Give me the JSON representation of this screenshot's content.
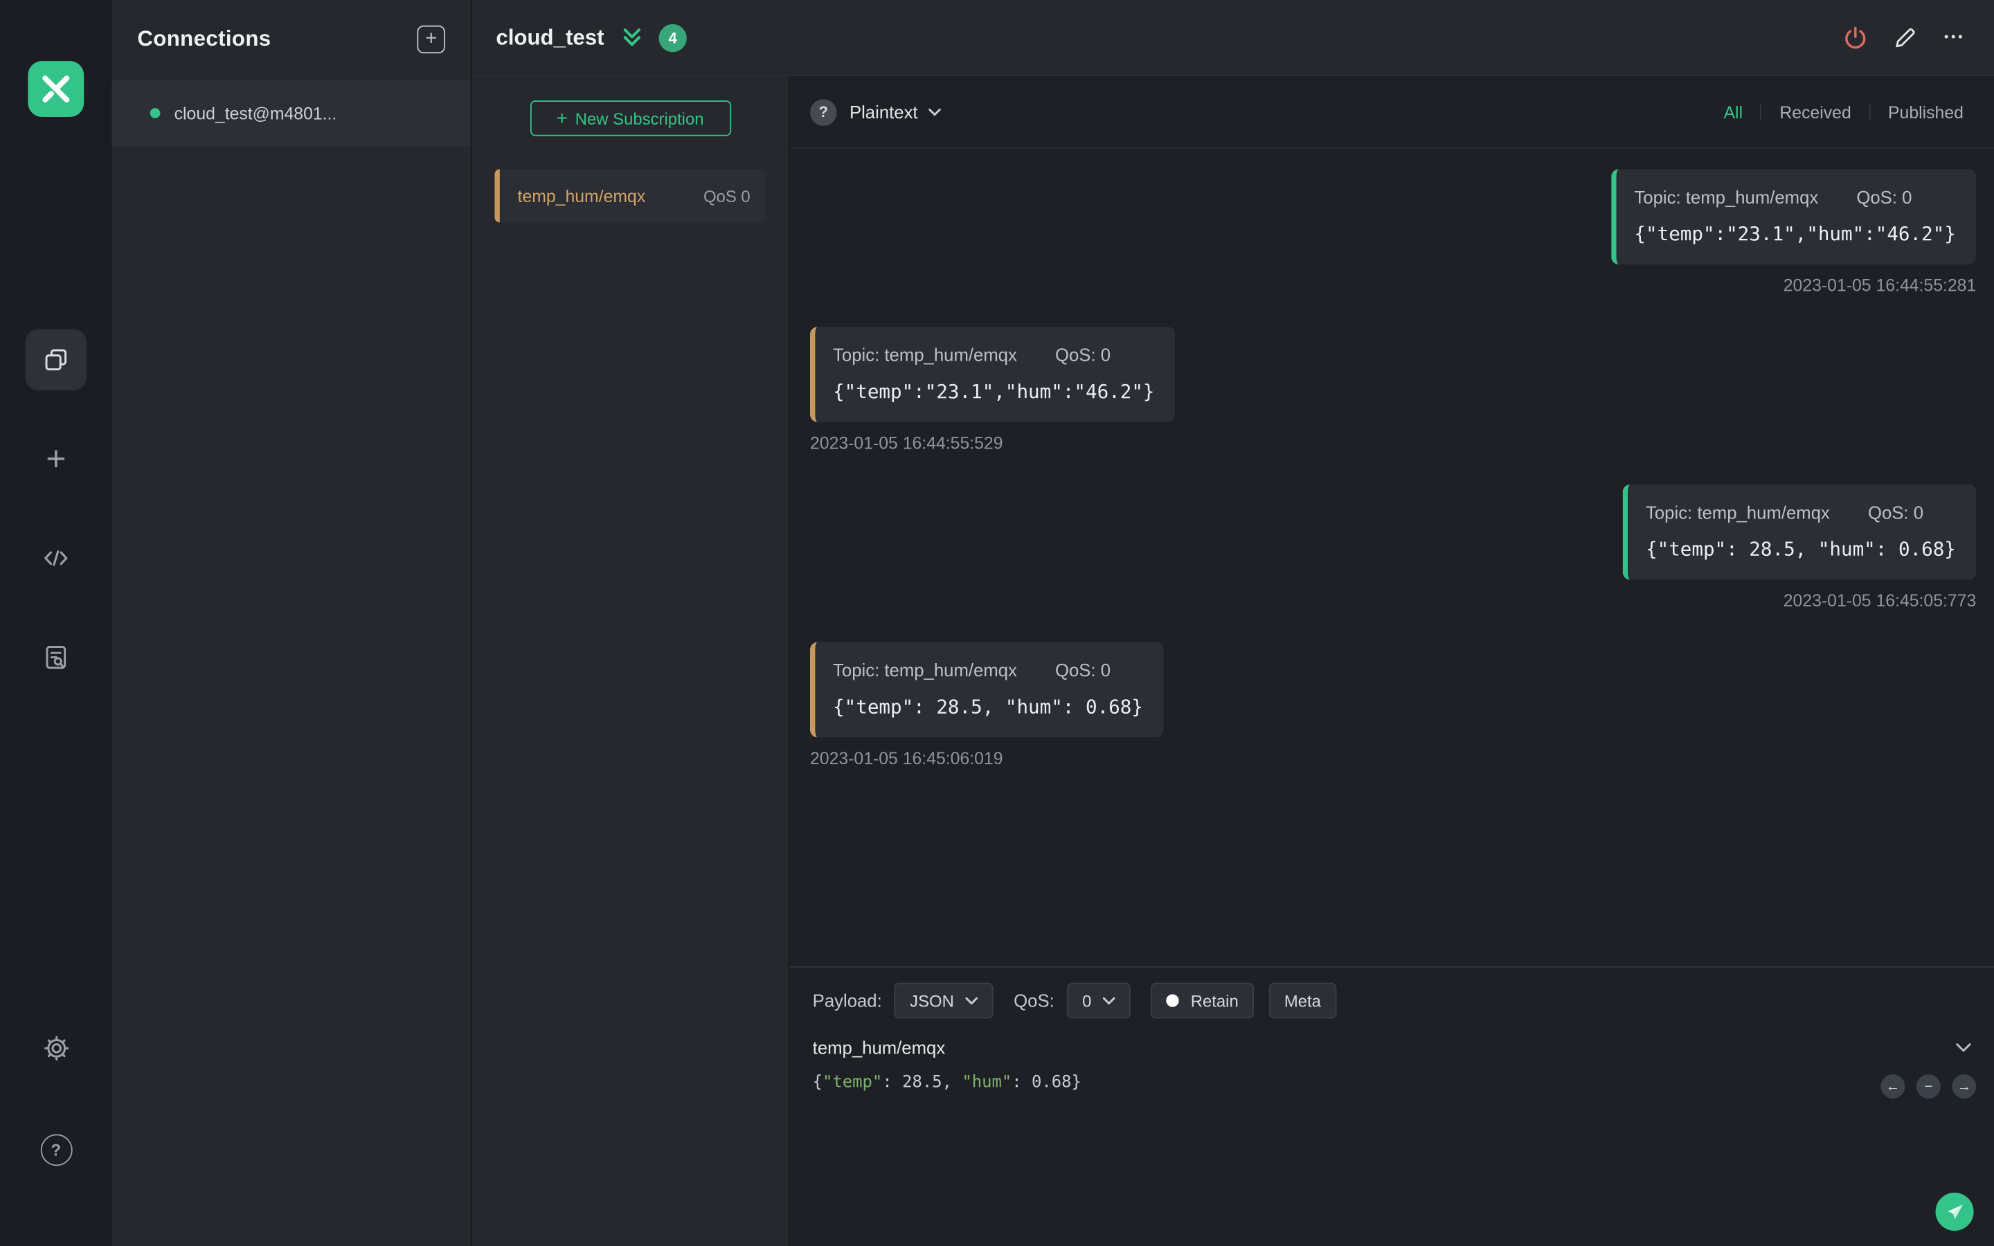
{
  "colors": {
    "accent_green": "#34c388",
    "accent_orange": "#c9985f",
    "danger_red": "#dc6a5c"
  },
  "icons": {
    "add": "+",
    "more": "•••",
    "question": "?",
    "back_arrow": "←",
    "minus": "−",
    "forward_arrow": "→"
  },
  "connections": {
    "title": "Connections",
    "items": [
      {
        "name": "cloud_test@m4801...",
        "status": "connected"
      }
    ]
  },
  "header": {
    "title": "cloud_test",
    "badge_count": "4"
  },
  "subscriptions": {
    "new_button_label": "New Subscription",
    "items": [
      {
        "topic": "temp_hum/emqx",
        "qos_label": "QoS 0"
      }
    ]
  },
  "toolbar": {
    "format_label": "Plaintext",
    "filters": [
      "All",
      "Received",
      "Published"
    ],
    "active_filter": "All"
  },
  "messages": [
    {
      "direction": "published",
      "topic_label": "Topic: temp_hum/emqx",
      "qos_label": "QoS: 0",
      "payload": "{\"temp\":\"23.1\",\"hum\":\"46.2\"}",
      "timestamp": "2023-01-05 16:44:55:281"
    },
    {
      "direction": "received",
      "topic_label": "Topic: temp_hum/emqx",
      "qos_label": "QoS: 0",
      "payload": "{\"temp\":\"23.1\",\"hum\":\"46.2\"}",
      "timestamp": "2023-01-05 16:44:55:529"
    },
    {
      "direction": "published",
      "topic_label": "Topic: temp_hum/emqx",
      "qos_label": "QoS: 0",
      "payload": "{\"temp\": 28.5, \"hum\": 0.68}",
      "timestamp": "2023-01-05 16:45:05:773"
    },
    {
      "direction": "received",
      "topic_label": "Topic: temp_hum/emqx",
      "qos_label": "QoS: 0",
      "payload": "{\"temp\": 28.5, \"hum\": 0.68}",
      "timestamp": "2023-01-05 16:45:06:019"
    }
  ],
  "publish": {
    "payload_label": "Payload:",
    "format_value": "JSON",
    "qos_label": "QoS:",
    "qos_value": "0",
    "retain_label": "Retain",
    "meta_label": "Meta",
    "topic_value": "temp_hum/emqx",
    "editor": {
      "p0": "{",
      "p1": "\"temp\"",
      "p2": ": 28.5, ",
      "p3": "\"hum\"",
      "p4": ": 0.68}"
    }
  }
}
